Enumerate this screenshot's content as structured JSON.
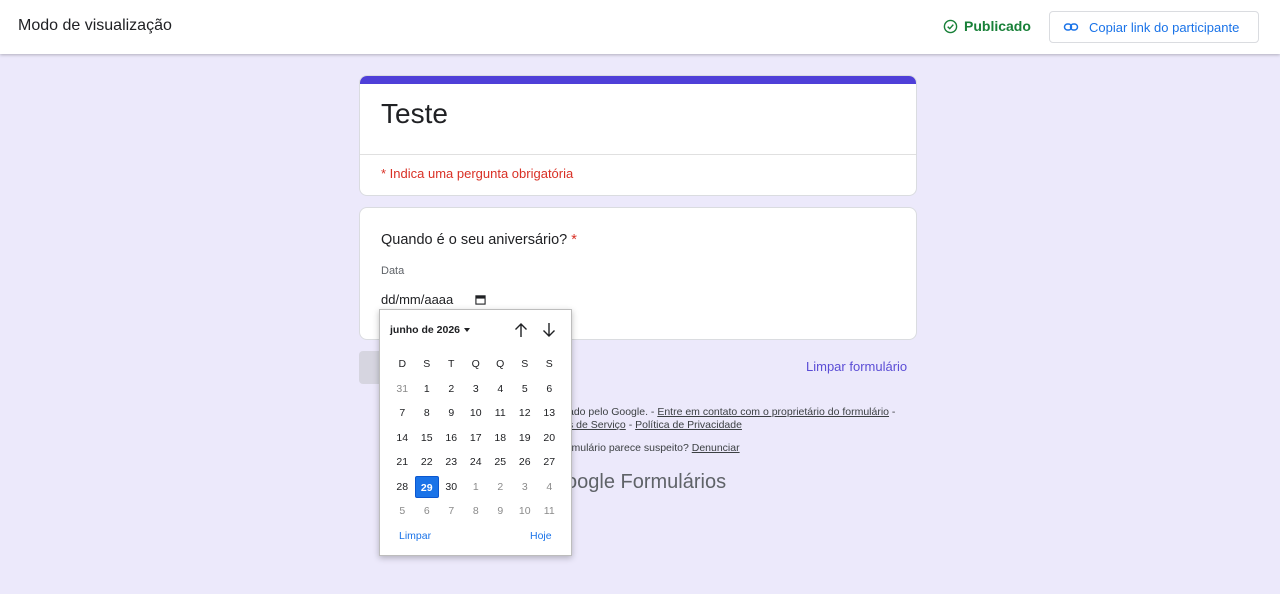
{
  "topbar": {
    "title": "Modo de visualização",
    "status": "Publicado",
    "copy_link_label": "Copiar link do participante",
    "status_color": "#188038",
    "accent_color": "#1a73e8"
  },
  "form": {
    "title": "Teste",
    "required_note": "* Indica uma pergunta obrigatória",
    "accent_color": "#4f3fd8"
  },
  "question": {
    "text": "Quando é o seu aniversário?",
    "required_mark": "*",
    "field_label": "Data",
    "date_placeholder": "dd/mm/aaaa"
  },
  "actions": {
    "clear_form": "Limpar formulário"
  },
  "footer": {
    "line1_prefix": "ado pelo Google. - ",
    "contact_link": "Entre em contato com o proprietário do formulário",
    "line1_suffix": " -",
    "terms_link": "s de Serviço",
    "sep": " - ",
    "privacy_link": "Política de Privacidade",
    "line3_prefix": "rmulário parece suspeito? ",
    "report_link": "Denunciar",
    "brand_google": "oogle",
    "brand_product": " Formulários"
  },
  "calendar": {
    "month_label": "junho de 2026",
    "weekdays": [
      "D",
      "S",
      "T",
      "Q",
      "Q",
      "S",
      "S"
    ],
    "weeks": [
      [
        "31",
        "1",
        "2",
        "3",
        "4",
        "5",
        "6"
      ],
      [
        "7",
        "8",
        "9",
        "10",
        "11",
        "12",
        "13"
      ],
      [
        "14",
        "15",
        "16",
        "17",
        "18",
        "19",
        "20"
      ],
      [
        "21",
        "22",
        "23",
        "24",
        "25",
        "26",
        "27"
      ],
      [
        "28",
        "29",
        "30",
        "1",
        "2",
        "3",
        "4"
      ],
      [
        "5",
        "6",
        "7",
        "8",
        "9",
        "10",
        "11"
      ]
    ],
    "selected": "29",
    "clear_label": "Limpar",
    "today_label": "Hoje",
    "icons": [
      "arrow-up-icon",
      "arrow-down-icon",
      "caret-down-icon"
    ]
  }
}
